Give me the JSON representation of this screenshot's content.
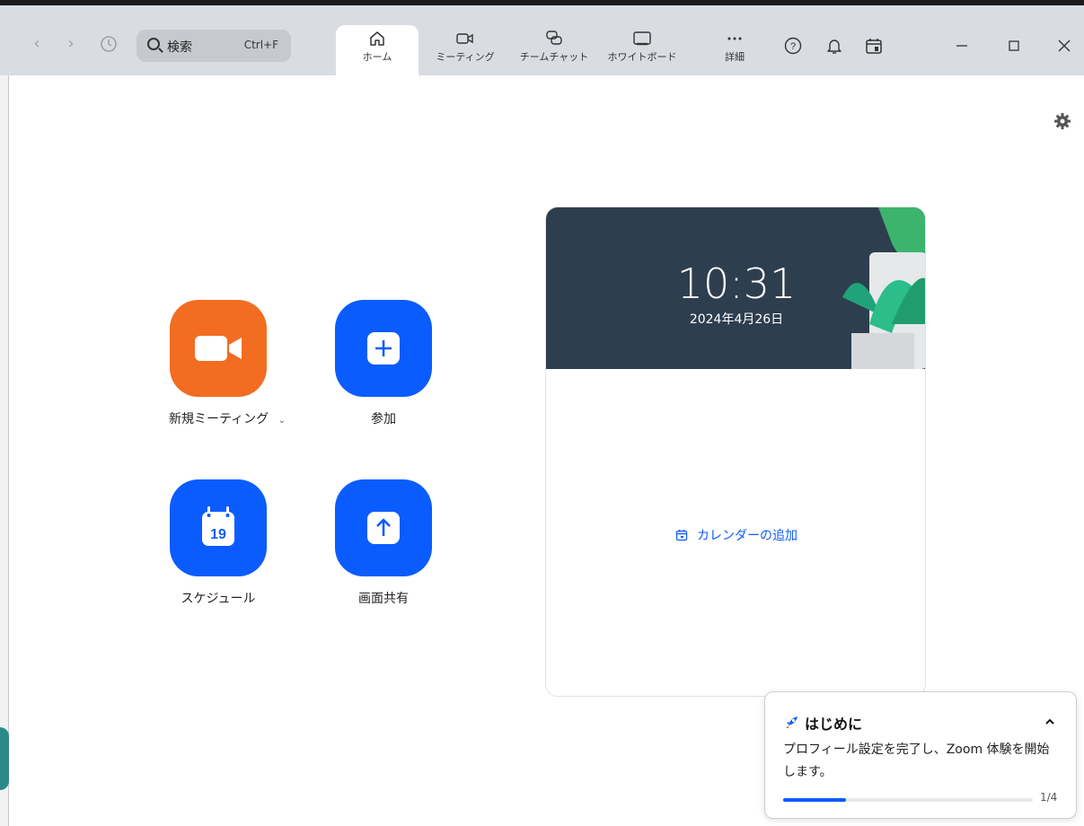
{
  "search": {
    "placeholder": "検索",
    "shortcut": "Ctrl+F"
  },
  "tabs": [
    {
      "label": "ホーム",
      "icon": "home-icon",
      "active": true
    },
    {
      "label": "ミーティング",
      "icon": "video-camera-icon",
      "active": false
    },
    {
      "label": "チームチャット",
      "icon": "chat-bubbles-icon",
      "active": false
    },
    {
      "label": "ホワイトボード",
      "icon": "whiteboard-icon",
      "active": false
    },
    {
      "label": "詳細",
      "icon": "more-dots-icon",
      "active": false
    }
  ],
  "header_icons": [
    "help-icon",
    "bell-icon",
    "calendar-icon"
  ],
  "actions": {
    "new_meeting": "新規ミーティング",
    "join": "参加",
    "schedule": "スケジュール",
    "schedule_day": "19",
    "share_screen": "画面共有"
  },
  "card": {
    "time": "10:31",
    "date": "2024年4月26日",
    "add_calendar": "カレンダーの追加"
  },
  "onboarding": {
    "title": "はじめに",
    "body": "プロフィール設定を完了し、Zoom 体験を開始します。",
    "step": "1/4",
    "progress_fraction": 0.25
  },
  "colors": {
    "accent": "#0b5cff",
    "new_meeting": "#f26d21",
    "banner": "#2d3e4f",
    "topbar": "#d9dde2"
  }
}
